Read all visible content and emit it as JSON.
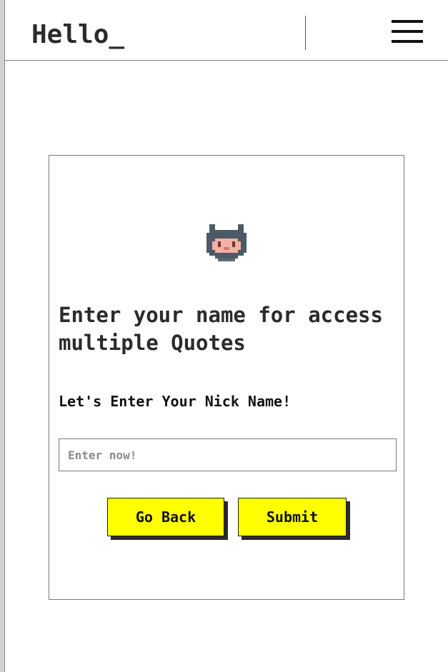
{
  "header": {
    "brand": "Hello_",
    "menu_icon": "hamburger-menu-icon"
  },
  "card": {
    "avatar_icon": "octocat-avatar-icon",
    "title": "Enter your name for access multiple Quotes",
    "prompt": "Let's Enter Your Nick Name!",
    "input": {
      "value": "",
      "placeholder": "Enter now!"
    },
    "buttons": {
      "back_label": "Go Back",
      "submit_label": "Submit"
    }
  },
  "colors": {
    "button_bg": "#ffff00",
    "button_shadow": "#2b2b2b",
    "text": "#2b2b2b"
  }
}
